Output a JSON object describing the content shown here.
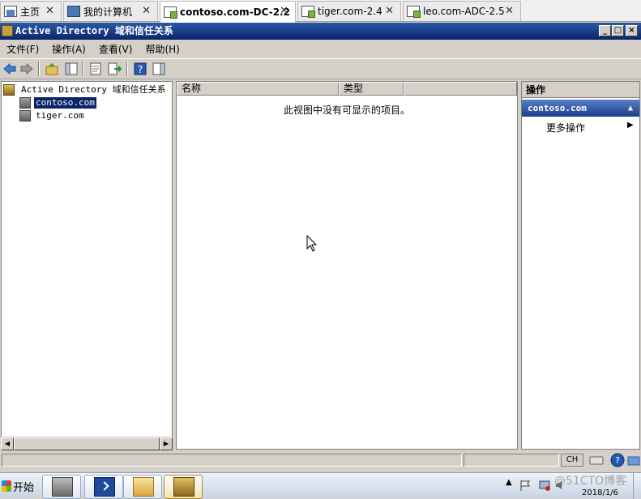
{
  "vm_tabs": [
    {
      "label": "主页",
      "icon": "home-icon",
      "active": false
    },
    {
      "label": "我的计算机",
      "icon": "computer-icon",
      "active": false
    },
    {
      "label": "contoso.com-DC-2.2",
      "icon": "vm-icon",
      "active": true
    },
    {
      "label": "tiger.com-2.4",
      "icon": "vm-icon",
      "active": false
    },
    {
      "label": "leo.com-ADC-2.5",
      "icon": "vm-icon",
      "active": false
    }
  ],
  "tab_close_glyph": "✕",
  "window": {
    "title": "Active Directory 域和信任关系",
    "minimize": "_",
    "maximize": "□",
    "close": "×"
  },
  "menu": [
    "文件(F)",
    "操作(A)",
    "查看(V)",
    "帮助(H)"
  ],
  "toolbar_icons": [
    "back-arrow-icon",
    "forward-arrow-icon",
    "up-folder-icon",
    "show-hide-tree-icon",
    "properties-icon",
    "export-list-icon",
    "help-icon",
    "show-hide-action-pane-icon"
  ],
  "tree": {
    "root": "Active Directory 域和信任关系 [",
    "children": [
      {
        "label": "contoso.com",
        "selected": true
      },
      {
        "label": "tiger.com",
        "selected": false
      }
    ]
  },
  "list": {
    "columns": [
      "名称",
      "类型"
    ],
    "empty_message": "此视图中没有可显示的项目。"
  },
  "actions": {
    "header": "操作",
    "section": "contoso.com",
    "section_caret": "▲",
    "item": "更多操作",
    "item_arrow": "▶"
  },
  "taskbar": {
    "start": "开始",
    "apps": [
      "server-manager-icon",
      "powershell-icon",
      "explorer-folder-icon",
      "ad-domains-icon"
    ],
    "tray_lang": "CH",
    "clock_date": "2018/1/6"
  },
  "watermark": "@51CTO博客",
  "colors": {
    "title_gradient_top": "#2a5aa8",
    "title_gradient_bottom": "#0a246a",
    "selection": "#0a246a",
    "action_section": "#1c3e8c",
    "chrome": "#d4d0c8"
  }
}
